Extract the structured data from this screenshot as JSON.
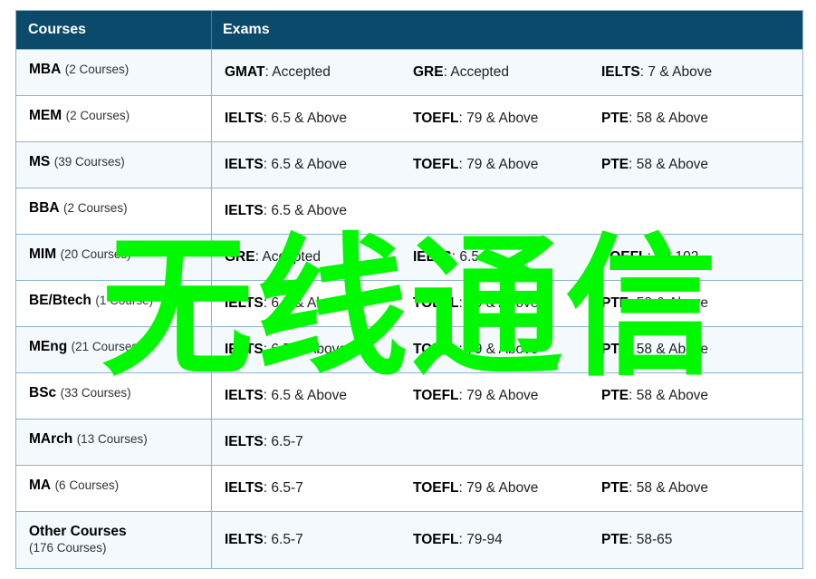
{
  "header": {
    "courses": "Courses",
    "exams": "Exams"
  },
  "rows": [
    {
      "name": "MBA",
      "count": "(2 Courses)",
      "exams": [
        {
          "label": "GMAT",
          "value": ": Accepted"
        },
        {
          "label": "GRE",
          "value": ": Accepted"
        },
        {
          "label": "IELTS",
          "value": ": 7 & Above"
        }
      ]
    },
    {
      "name": "MEM",
      "count": "(2 Courses)",
      "exams": [
        {
          "label": "IELTS",
          "value": ": 6.5 & Above"
        },
        {
          "label": "TOEFL",
          "value": ": 79 & Above"
        },
        {
          "label": "PTE",
          "value": ": 58 & Above"
        }
      ]
    },
    {
      "name": "MS",
      "count": "(39 Courses)",
      "exams": [
        {
          "label": "IELTS",
          "value": ": 6.5 & Above"
        },
        {
          "label": "TOEFL",
          "value": ": 79 & Above"
        },
        {
          "label": "PTE",
          "value": ": 58 & Above"
        }
      ]
    },
    {
      "name": "BBA",
      "count": "(2 Courses)",
      "exams": [
        {
          "label": "IELTS",
          "value": ": 6.5 & Above"
        }
      ]
    },
    {
      "name": "MIM",
      "count": "(20 Courses)",
      "exams": [
        {
          "label": "GRE",
          "value": ": Accepted"
        },
        {
          "label": "IELTS",
          "value": ": 6.5-7"
        },
        {
          "label": "TOEFL",
          "value": ": 79-102"
        }
      ]
    },
    {
      "name": "BE/Btech",
      "count": "(1 Course)",
      "exams": [
        {
          "label": "IELTS",
          "value": ": 6.5 & Above"
        },
        {
          "label": "TOEFL",
          "value": ": 79 & Above"
        },
        {
          "label": "PTE",
          "value": ": 58 & Above"
        }
      ]
    },
    {
      "name": "MEng",
      "count": "(21 Courses)",
      "exams": [
        {
          "label": "IELTS",
          "value": ": 6.5 & Above"
        },
        {
          "label": "TOEFL",
          "value": ": 79 & Above"
        },
        {
          "label": "PTE",
          "value": ": 58 & Above"
        }
      ]
    },
    {
      "name": "BSc",
      "count": "(33 Courses)",
      "exams": [
        {
          "label": "IELTS",
          "value": ": 6.5 & Above"
        },
        {
          "label": "TOEFL",
          "value": ": 79 & Above"
        },
        {
          "label": "PTE",
          "value": ": 58 & Above"
        }
      ]
    },
    {
      "name": "MArch",
      "count": "(13 Courses)",
      "exams": [
        {
          "label": "IELTS",
          "value": ": 6.5-7"
        }
      ]
    },
    {
      "name": "MA",
      "count": "(6 Courses)",
      "exams": [
        {
          "label": "IELTS",
          "value": ": 6.5-7"
        },
        {
          "label": "TOEFL",
          "value": ": 79 & Above"
        },
        {
          "label": "PTE",
          "value": ": 58 & Above"
        }
      ]
    },
    {
      "name": "Other Courses",
      "count": "(176 Courses)",
      "exams": [
        {
          "label": "IELTS",
          "value": ": 6.5-7"
        },
        {
          "label": "TOEFL",
          "value": ": 79-94"
        },
        {
          "label": "PTE",
          "value": ": 58-65"
        }
      ]
    }
  ],
  "overlay": {
    "chars": [
      "无",
      "线",
      "通",
      "信"
    ],
    "color": "#00f800"
  }
}
